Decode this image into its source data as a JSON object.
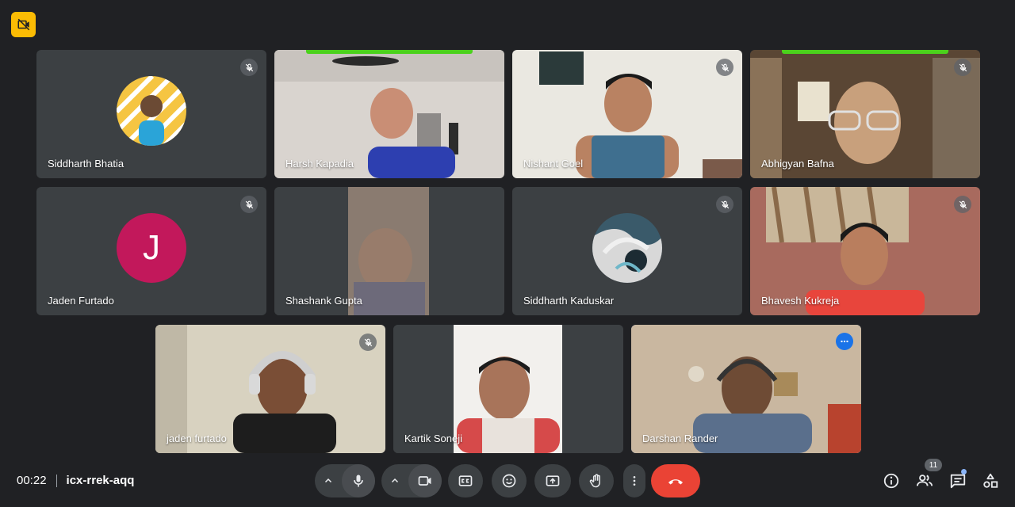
{
  "participants": [
    {
      "name": "Siddharth Bhatia"
    },
    {
      "name": "Harsh Kapadia"
    },
    {
      "name": "Nishant Goel"
    },
    {
      "name": "Abhigyan Bafna"
    },
    {
      "name": "Jaden Furtado",
      "initial": "J",
      "avatar_color": "#c2185b"
    },
    {
      "name": "Shashank Gupta"
    },
    {
      "name": "Siddharth Kaduskar"
    },
    {
      "name": "Bhavesh Kukreja"
    },
    {
      "name": "jaden furtado"
    },
    {
      "name": "Kartik Soneji"
    },
    {
      "name": "Darshan Rander"
    }
  ],
  "meeting": {
    "time": "00:22",
    "code": "icx-rrek-aqq"
  },
  "people_count": "11",
  "colors": {
    "background": "#202124",
    "tile": "#3c4043",
    "end_call": "#ea4335",
    "speaking": "#4bd11c",
    "badge": "#fbbc04",
    "active_outline": "#8ab4f8"
  },
  "icons": {
    "badge": "camera-off-icon",
    "tile_muted": "mic-off-icon",
    "tile_options": "more-horizontal-icon",
    "controls": [
      "chevron-up-icon",
      "mic-icon",
      "chevron-up-icon",
      "camera-icon",
      "captions-icon",
      "emoji-icon",
      "present-icon",
      "raise-hand-icon",
      "more-vertical-icon",
      "end-call-icon"
    ],
    "right": [
      "info-icon",
      "people-icon",
      "chat-icon",
      "activities-icon"
    ]
  }
}
